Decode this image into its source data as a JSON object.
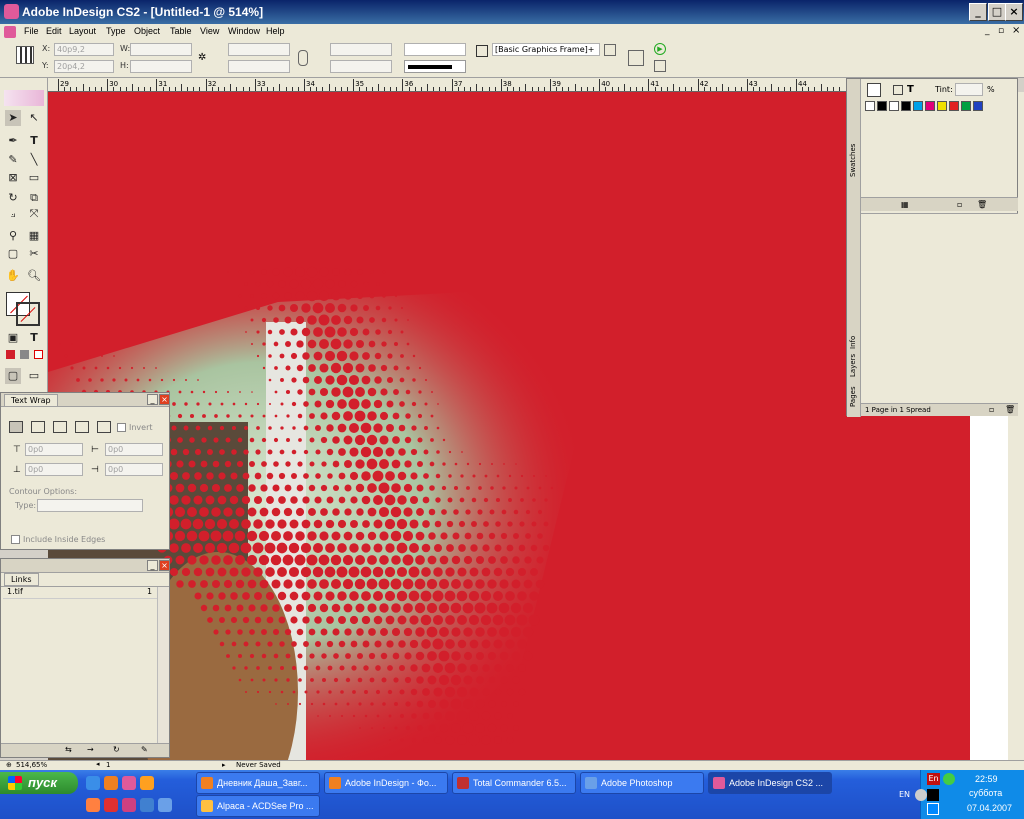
{
  "window": {
    "title": "Adobe InDesign CS2 - [Untitled-1 @ 514%]"
  },
  "menu": [
    "File",
    "Edit",
    "Layout",
    "Type",
    "Object",
    "Table",
    "View",
    "Window",
    "Help"
  ],
  "control": {
    "x_label": "X:",
    "x_value": "40p9,2",
    "y_label": "Y:",
    "y_value": "20p4,2",
    "w_label": "W:",
    "h_label": "H:",
    "object_style": "[Basic Graphics Frame]+"
  },
  "ruler_ticks": [
    "29",
    "30",
    "31",
    "32",
    "33",
    "34",
    "35",
    "36",
    "37",
    "38",
    "39",
    "40",
    "41",
    "42",
    "43",
    "44"
  ],
  "swatches_panel": {
    "tab": "Swatches",
    "side_tabs": [
      "Swatches",
      "Info",
      "Layers",
      "Pages"
    ],
    "tint_label": "Tint:",
    "tint_unit": "%",
    "status": "1 Page in 1 Spread",
    "colors": [
      "#ffffff",
      "#000000",
      "#ffffff",
      "#000000",
      "#00a0e8",
      "#e0007a",
      "#f0e000",
      "#e02020",
      "#00a040",
      "#2040c0"
    ]
  },
  "textwrap_panel": {
    "title": "Text Wrap",
    "invert": "Invert",
    "offsets": [
      "0p0",
      "0p0",
      "0p0",
      "0p0"
    ],
    "contour_label": "Contour Options:",
    "type_label": "Type:",
    "include_edges": "Include Inside Edges"
  },
  "links_panel": {
    "title": "Links",
    "items": [
      {
        "name": "1.tif",
        "page": "1"
      }
    ]
  },
  "statusbar": {
    "zoom": "514,65%",
    "page": "1",
    "status": "Never Saved"
  },
  "taskbar": {
    "start": "пуск",
    "buttons": [
      "Дневник Даша_Завг...",
      "Adobe InDesign - Фо...",
      "Total Commander 6.5...",
      "Adobe Photoshop",
      "Adobe InDesign CS2 ...",
      "Alpaca - ACDSee Pro ..."
    ],
    "active_index": 4,
    "lang": "EN",
    "lang_indicator": "En",
    "time": "22:59",
    "day": "суббота",
    "date": "07.04.2007"
  }
}
